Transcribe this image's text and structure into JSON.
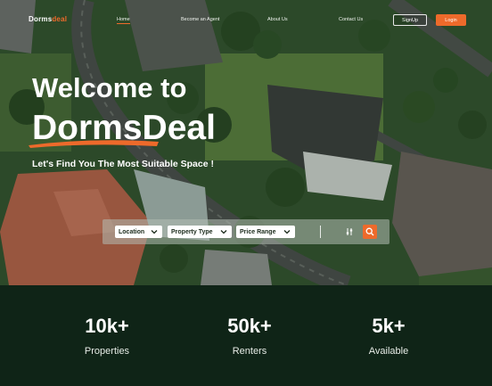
{
  "brand": {
    "name_part1": "Dorms",
    "name_part2": "deal",
    "accent_color": "#ee6a2b"
  },
  "nav": {
    "links": [
      "Home",
      "Become an Agent",
      "About Us",
      "Contact Us"
    ],
    "signup_label": "SignUp",
    "login_label": "Login"
  },
  "hero": {
    "headline_line1": "Welcome to",
    "headline_line2": "DormsDeal",
    "subheadline": "Let's Find You The Most Suitable Space !"
  },
  "search": {
    "filters": [
      "Location",
      "Property Type",
      "Price Range"
    ],
    "icons": {
      "filter": "sliders-icon",
      "search": "search-icon",
      "dropdown": "chevron-down-icon"
    }
  },
  "stats": [
    {
      "value": "10k+",
      "label": "Properties"
    },
    {
      "value": "50k+",
      "label": "Renters"
    },
    {
      "value": "5k+",
      "label": "Available"
    }
  ],
  "colors": {
    "dark_green": "#0f2417",
    "accent": "#ee6a2b"
  }
}
